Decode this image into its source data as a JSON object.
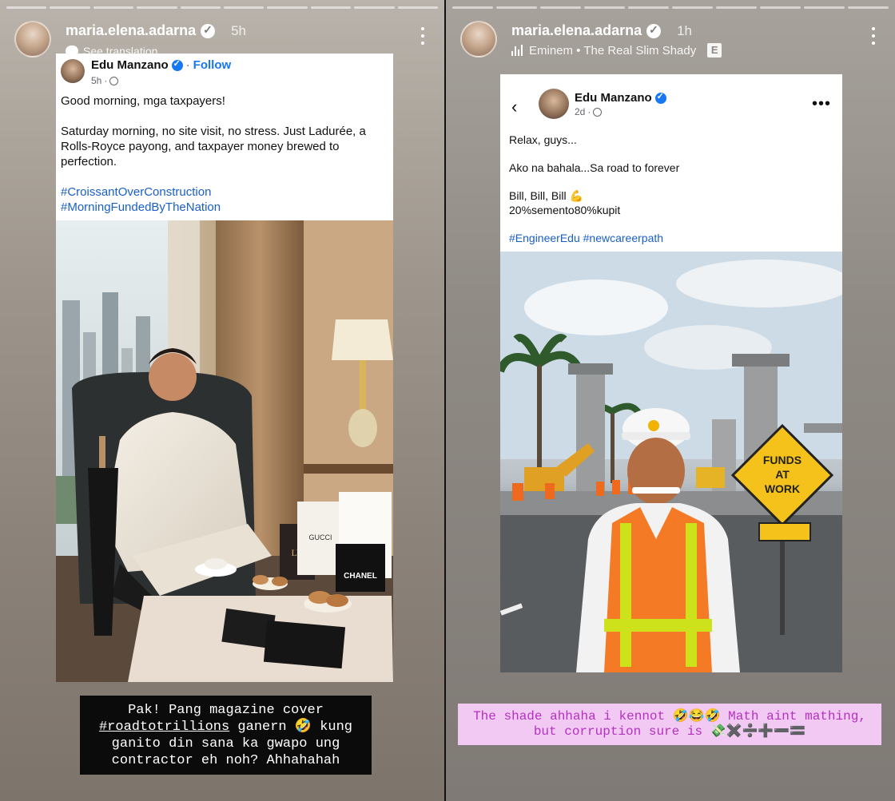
{
  "left_story": {
    "username": "maria.elena.adarna",
    "time": "5h",
    "see_translation": "See translation",
    "post": {
      "author": "Edu Manzano",
      "follow": "Follow",
      "meta_time": "5h",
      "line1": "Good morning, mga taxpayers!",
      "line2": "Saturday morning, no site visit, no stress. Just Ladurée, a Rolls-Royce payong, and taxpayer money brewed to perfection.",
      "tag1": "#CroissantOverConstruction",
      "tag2": "#MorningFundedByTheNation"
    },
    "photo_brands": {
      "lv": "LV",
      "gucci": "GUCCI",
      "chanel": "CHANEL"
    },
    "caption": {
      "part1": "Pak! Pang magazine cover",
      "tag": "#roadtotrillions",
      "part2": "ganern 🤣 kung ganito din sana ka gwapo ung contractor eh noh? Ahhahahah"
    }
  },
  "right_story": {
    "username": "maria.elena.adarna",
    "time": "1h",
    "music": "Eminem • The Real Slim Shady",
    "explicit": "E",
    "post": {
      "author": "Edu Manzano",
      "meta_time": "2d",
      "line1": "Relax, guys...",
      "line2": "Ako na bahala...Sa road to forever",
      "line3": "Bill, Bill, Bill 💪",
      "line4": "20%semento80%kupit",
      "tags": "#EngineerEdu #newcareerpath"
    },
    "sign_text": "FUNDS AT WORK",
    "caption": {
      "line1": "The shade ahhaha i kennot 🤣😂🤣 Math aint mathing,",
      "line2": "but corruption sure is 💸✖️➗➕➖🟰"
    }
  },
  "colors": {
    "fb_blue": "#1877f2",
    "hashtag_blue": "#1a5fc6",
    "caption_pink_bg": "#f1c9f3",
    "caption_pink_text": "#b431c0",
    "sign_yellow": "#f4c21a"
  }
}
